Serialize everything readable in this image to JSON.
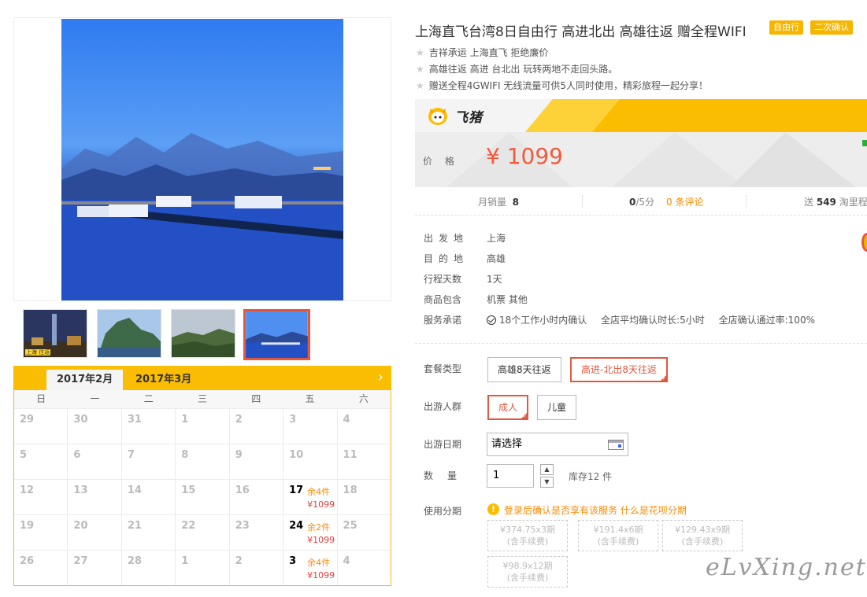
{
  "product": {
    "title": "上海直飞台湾8日自由行 高进北出 高雄往返 赠全程WIFI",
    "badges": [
      "自由行",
      "二次确认"
    ],
    "features": [
      "吉祥承运 上海直飞 拒绝廉价",
      "高雄往返 高进 台北出 玩转两地不走回头路。",
      "赠送全程4GWIFI 无线流量可供5人同时使用，精彩旅程一起分享！"
    ]
  },
  "brand": {
    "name": "飞猪"
  },
  "price": {
    "label": "价格",
    "value": "¥ 1099"
  },
  "stats": {
    "sales_label": "月销量",
    "sales_value": "8",
    "rating_value": "0",
    "rating_suffix": "/5分",
    "reviews": "0 条评论",
    "points_prefix": "送",
    "points_value": "549",
    "points_suffix": "淘里程"
  },
  "info": [
    {
      "label": "出发地",
      "value": "上海"
    },
    {
      "label": "目的地",
      "value": "高雄"
    },
    {
      "label": "行程天数",
      "value": "1天"
    },
    {
      "label": "商品包含",
      "value": "机票  其他"
    }
  ],
  "service": {
    "label": "服务承诺",
    "items": [
      "18个工作小时内确认",
      "全店平均确认时长:5小时",
      "全店确认通过率:100%"
    ]
  },
  "options": {
    "package_label": "套餐类型",
    "packages": [
      "高雄8天往返",
      "高进-北出8天往返"
    ],
    "traveler_label": "出游人群",
    "travelers": [
      "成人",
      "儿童"
    ],
    "date_label": "出游日期",
    "date_value": "请选择",
    "qty_label": "数量",
    "qty_value": "1",
    "qty_up": "▲",
    "qty_down": "▼",
    "stock": "库存12 件",
    "installment_label": "使用分期",
    "installment_notice": "登录后确认是否享有该服务",
    "installment_link": "什么是花呗分期",
    "installments": [
      {
        "amount": "¥374.75x3期",
        "fee": "(含手续费)"
      },
      {
        "amount": "¥191.4x6期",
        "fee": "(含手续费)"
      },
      {
        "amount": "¥129.43x9期",
        "fee": "(含手续费)"
      },
      {
        "amount": "¥98.9x12期",
        "fee": "(含手续费)"
      }
    ]
  },
  "gallery": {
    "thumb_label": "上海\n往返"
  },
  "calendar": {
    "tabs": [
      "2017年2月",
      "2017年3月"
    ],
    "next": "›",
    "weekdays": [
      "日",
      "一",
      "二",
      "三",
      "四",
      "五",
      "六"
    ],
    "rows": [
      [
        {
          "d": "29"
        },
        {
          "d": "30"
        },
        {
          "d": "31"
        },
        {
          "d": "1"
        },
        {
          "d": "2"
        },
        {
          "d": "3"
        },
        {
          "d": "4"
        }
      ],
      [
        {
          "d": "5"
        },
        {
          "d": "6"
        },
        {
          "d": "7"
        },
        {
          "d": "8"
        },
        {
          "d": "9"
        },
        {
          "d": "10"
        },
        {
          "d": "11"
        }
      ],
      [
        {
          "d": "12"
        },
        {
          "d": "13"
        },
        {
          "d": "14"
        },
        {
          "d": "15"
        },
        {
          "d": "16"
        },
        {
          "d": "17",
          "stock": "余4件",
          "price": "¥1099"
        },
        {
          "d": "18"
        }
      ],
      [
        {
          "d": "19"
        },
        {
          "d": "20"
        },
        {
          "d": "21"
        },
        {
          "d": "22"
        },
        {
          "d": "23"
        },
        {
          "d": "24",
          "stock": "余2件",
          "price": "¥1099"
        },
        {
          "d": "25"
        }
      ],
      [
        {
          "d": "26"
        },
        {
          "d": "27"
        },
        {
          "d": "28"
        },
        {
          "d": "1"
        },
        {
          "d": "2"
        },
        {
          "d": "3",
          "stock": "余4件",
          "price": "¥1099"
        },
        {
          "d": "4"
        }
      ]
    ]
  },
  "watermark": "eLvXing.net",
  "colors": {
    "accent": "#fbbd01",
    "price": "#f25a3c",
    "selected": "#e4573e",
    "link": "#ff8a00"
  }
}
